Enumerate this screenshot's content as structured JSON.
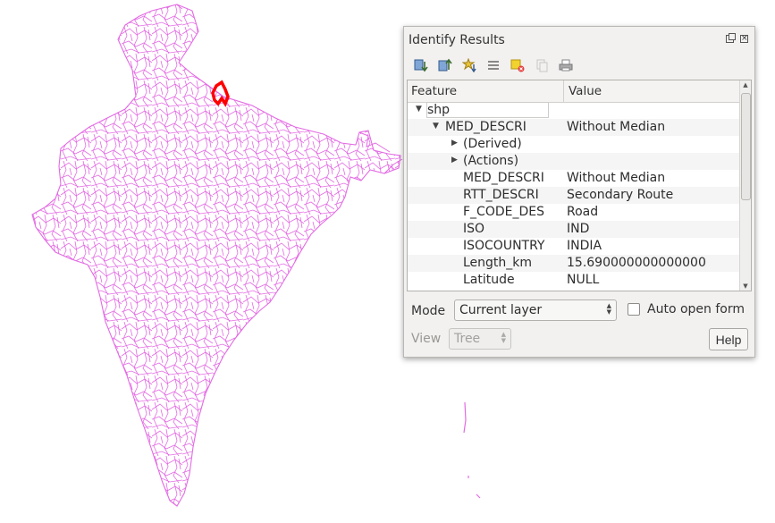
{
  "panel": {
    "title": "Identify Results"
  },
  "toolbar": {
    "icons": [
      "expand-tree-icon",
      "collapse-tree-icon",
      "expand-new-results-icon",
      "select-all-icon",
      "clear-results-icon",
      "copy-icon",
      "print-icon"
    ]
  },
  "tree": {
    "headers": {
      "feature": "Feature",
      "value": "Value"
    },
    "layer_name": "shp",
    "feature_node": {
      "label": "MED_DESCRI",
      "value": "Without Median"
    },
    "derived_label": "(Derived)",
    "actions_label": "(Actions)",
    "attributes": [
      {
        "name": "MED_DESCRI",
        "value": "Without Median"
      },
      {
        "name": "RTT_DESCRI",
        "value": "Secondary Route"
      },
      {
        "name": "F_CODE_DES",
        "value": "Road"
      },
      {
        "name": "ISO",
        "value": "IND"
      },
      {
        "name": "ISOCOUNTRY",
        "value": "INDIA"
      },
      {
        "name": "Length_km",
        "value": "15.690000000000000"
      },
      {
        "name": "Latitude",
        "value": "NULL"
      }
    ]
  },
  "mode": {
    "label": "Mode",
    "selected": "Current layer"
  },
  "auto_open": {
    "label": "Auto open form",
    "checked": false
  },
  "view": {
    "label": "View",
    "selected": "Tree"
  },
  "help_label": "Help",
  "colors": {
    "road_lines": "#e36be3",
    "selected_feature": "#ff0000",
    "panel_bg": "#f2f1f0"
  }
}
